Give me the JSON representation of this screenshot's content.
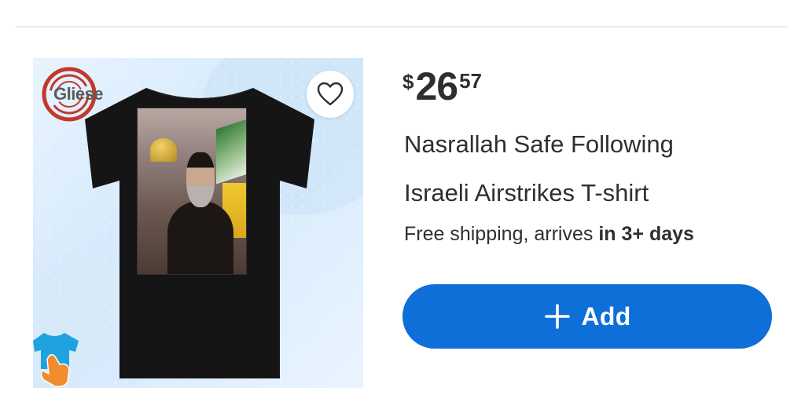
{
  "product": {
    "brand_logo_text": "Gliese",
    "price": {
      "currency": "$",
      "whole": "26",
      "cents": "57"
    },
    "title_line_1": "Nasrallah Safe Following",
    "title_line_2": "Israeli Airstrikes T-shirt",
    "shipping": {
      "prefix": "Free shipping, arrives ",
      "emphasis": "in 3+ days"
    },
    "add_button_label": "Add",
    "colors": {
      "accent": "#0f6fd8",
      "text": "#2e2f32",
      "logo_ring": "#c0392b",
      "badge": "#1fa3e0",
      "hand": "#f28a2e"
    },
    "icons": {
      "wishlist": "heart-icon",
      "add": "plus-icon",
      "logo": "brand-logo",
      "badge": "tshirt-tap-icon"
    }
  }
}
